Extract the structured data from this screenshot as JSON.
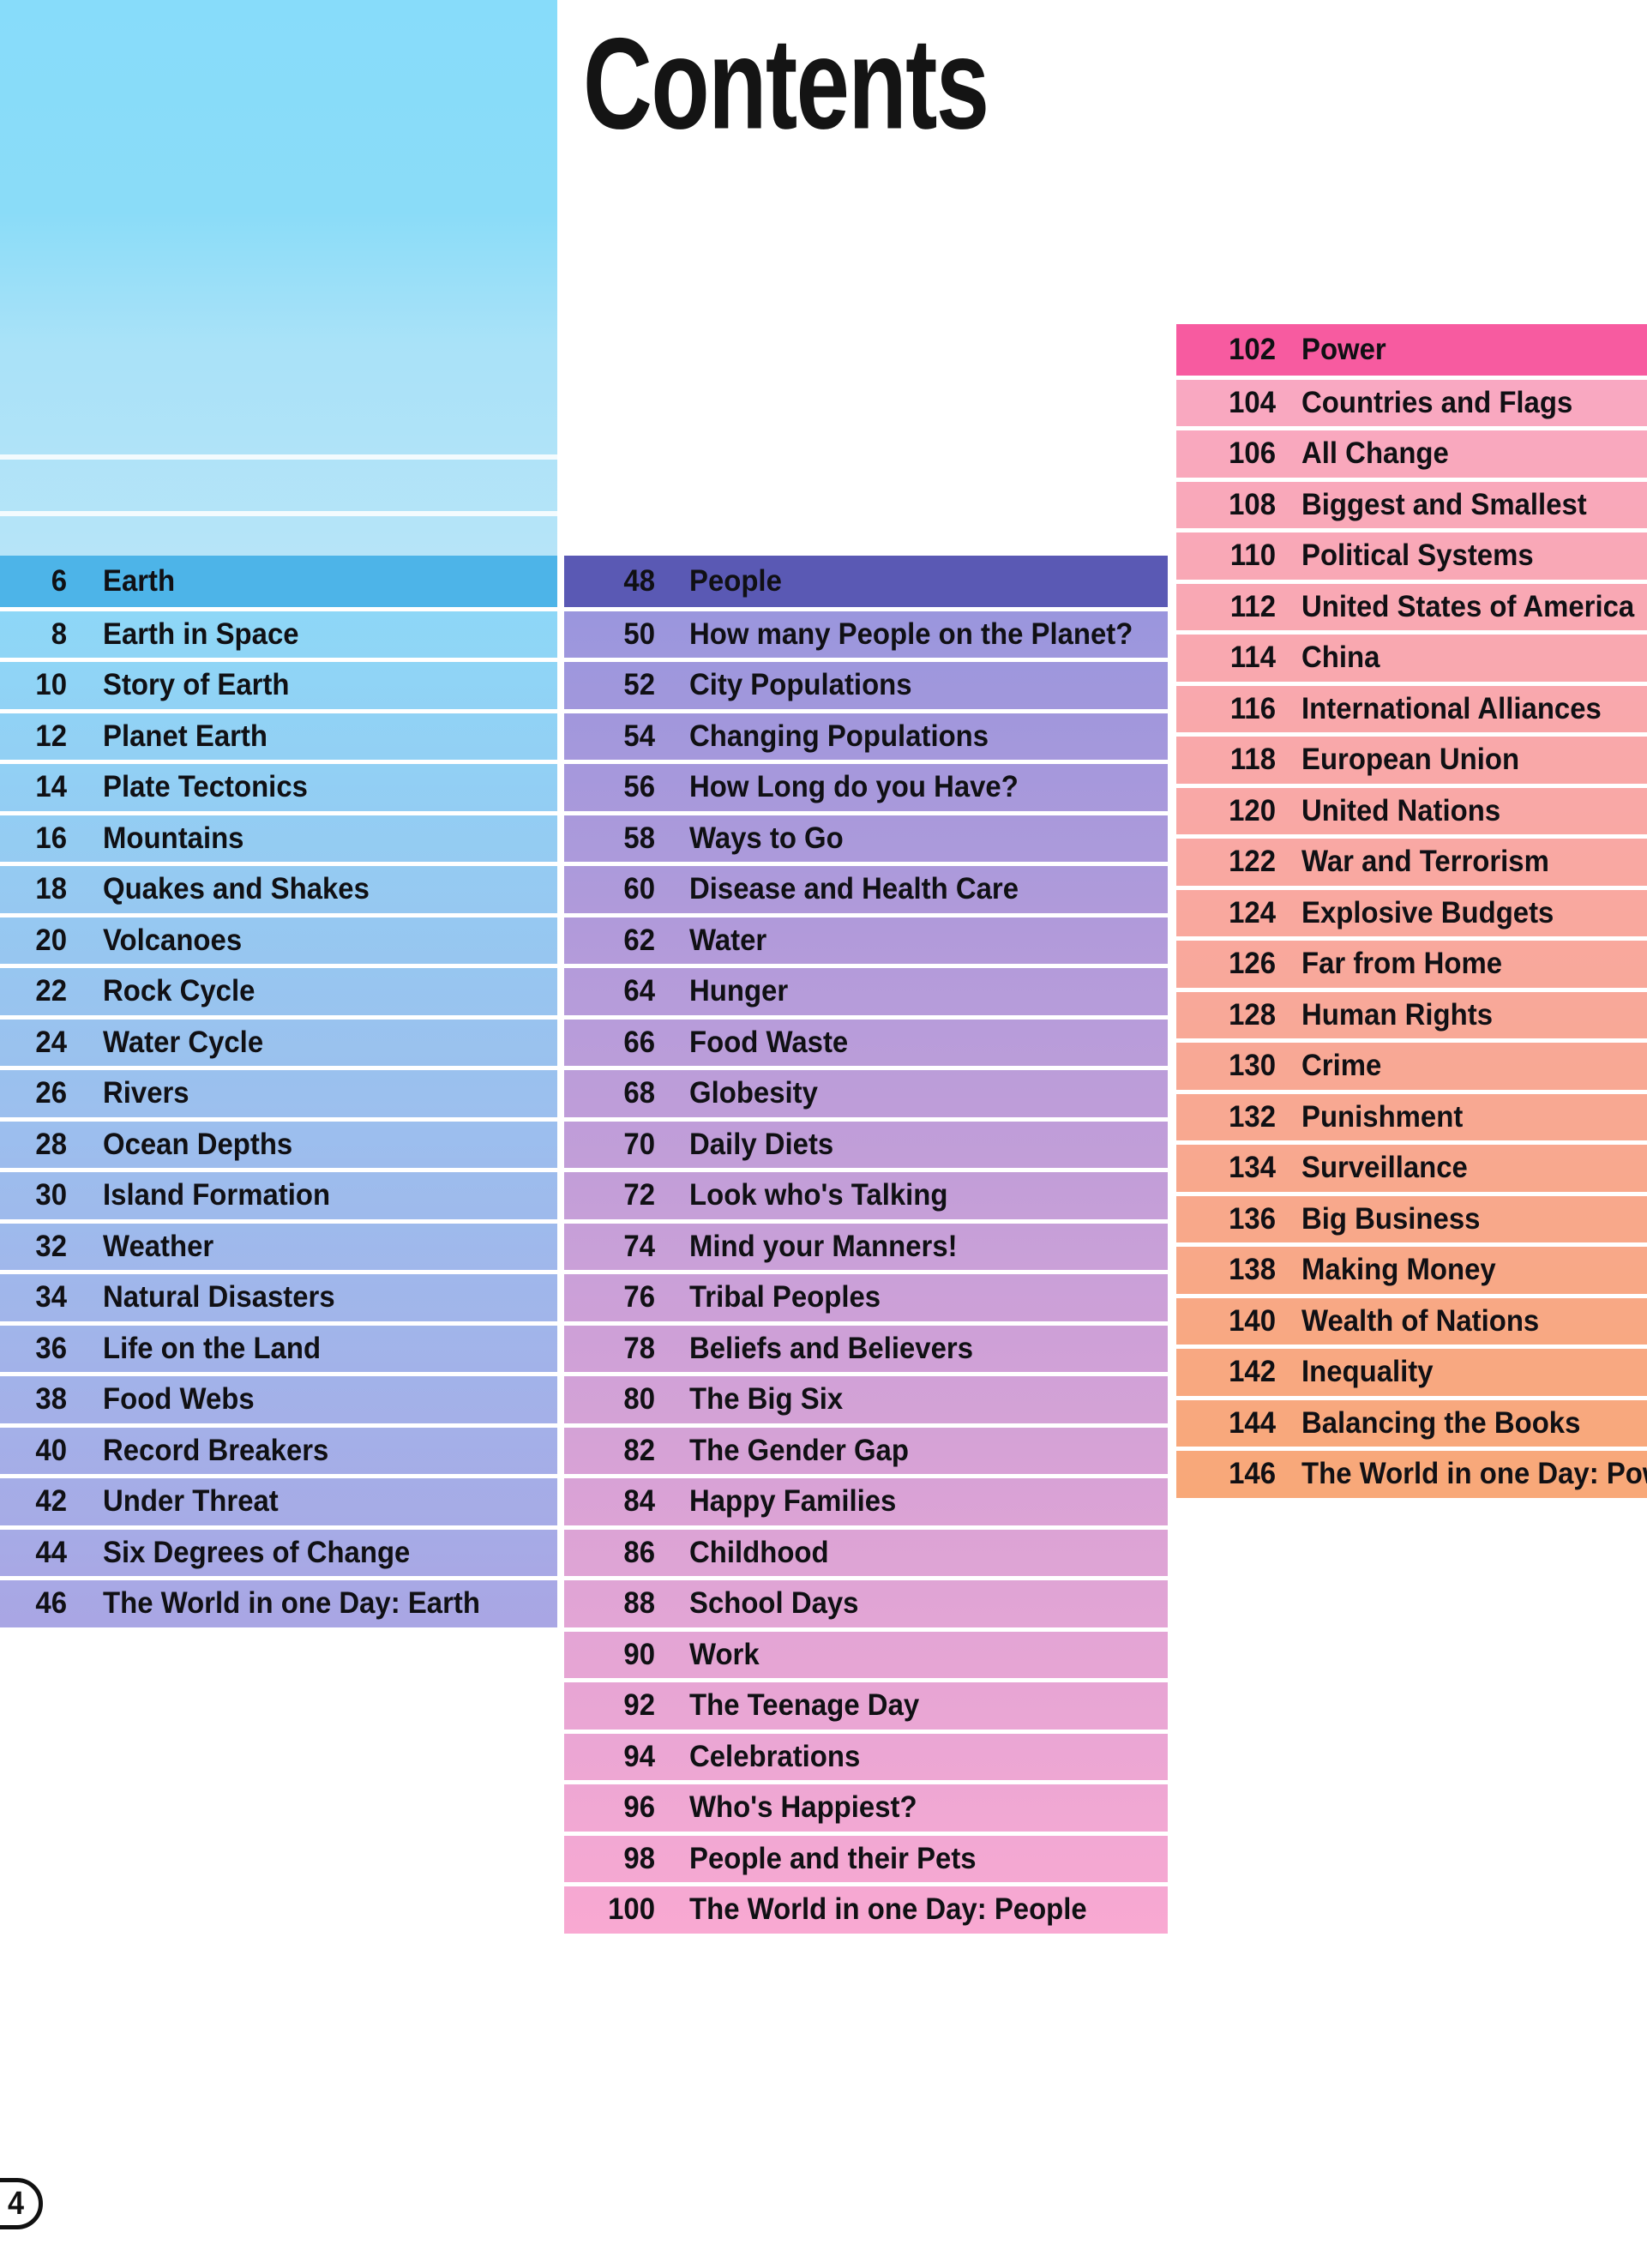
{
  "page": {
    "title": "Contents",
    "page_number": "4"
  },
  "colors": {
    "earth_top": "#87dcfa",
    "earth_header_row": "#4db4e8",
    "earth_bottom": "#a9a6e4",
    "people_header_row": "#5a59b4",
    "people_top": "#9a96dd",
    "people_bottom": "#f9a9d2",
    "power_header_row": "#f75ba0",
    "power_top": "#f9a8c2",
    "power_bottom": "#f8a878",
    "text": "#101014",
    "divider": "#ffffff"
  },
  "columns": [
    {
      "name": "earth",
      "header_index": 0,
      "entries": [
        {
          "page": "6",
          "title": "Earth"
        },
        {
          "page": "8",
          "title": "Earth in Space"
        },
        {
          "page": "10",
          "title": "Story of Earth"
        },
        {
          "page": "12",
          "title": "Planet Earth"
        },
        {
          "page": "14",
          "title": "Plate Tectonics"
        },
        {
          "page": "16",
          "title": "Mountains"
        },
        {
          "page": "18",
          "title": "Quakes and Shakes"
        },
        {
          "page": "20",
          "title": "Volcanoes"
        },
        {
          "page": "22",
          "title": "Rock Cycle"
        },
        {
          "page": "24",
          "title": "Water Cycle"
        },
        {
          "page": "26",
          "title": "Rivers"
        },
        {
          "page": "28",
          "title": "Ocean Depths"
        },
        {
          "page": "30",
          "title": "Island Formation"
        },
        {
          "page": "32",
          "title": "Weather"
        },
        {
          "page": "34",
          "title": "Natural Disasters"
        },
        {
          "page": "36",
          "title": "Life on the Land"
        },
        {
          "page": "38",
          "title": "Food Webs"
        },
        {
          "page": "40",
          "title": "Record Breakers"
        },
        {
          "page": "42",
          "title": "Under Threat"
        },
        {
          "page": "44",
          "title": "Six Degrees of Change"
        },
        {
          "page": "46",
          "title": "The World in one Day: Earth"
        }
      ]
    },
    {
      "name": "people",
      "header_index": 0,
      "entries": [
        {
          "page": "48",
          "title": "People"
        },
        {
          "page": "50",
          "title": "How many People on the Planet?"
        },
        {
          "page": "52",
          "title": "City Populations"
        },
        {
          "page": "54",
          "title": "Changing Populations"
        },
        {
          "page": "56",
          "title": "How Long do you Have?"
        },
        {
          "page": "58",
          "title": "Ways to Go"
        },
        {
          "page": "60",
          "title": "Disease and Health Care"
        },
        {
          "page": "62",
          "title": "Water"
        },
        {
          "page": "64",
          "title": "Hunger"
        },
        {
          "page": "66",
          "title": "Food Waste"
        },
        {
          "page": "68",
          "title": "Globesity"
        },
        {
          "page": "70",
          "title": "Daily Diets"
        },
        {
          "page": "72",
          "title": "Look who's Talking"
        },
        {
          "page": "74",
          "title": "Mind your Manners!"
        },
        {
          "page": "76",
          "title": "Tribal Peoples"
        },
        {
          "page": "78",
          "title": "Beliefs and Believers"
        },
        {
          "page": "80",
          "title": "The Big Six"
        },
        {
          "page": "82",
          "title": "The Gender Gap"
        },
        {
          "page": "84",
          "title": "Happy Families"
        },
        {
          "page": "86",
          "title": "Childhood"
        },
        {
          "page": "88",
          "title": "School Days"
        },
        {
          "page": "90",
          "title": "Work"
        },
        {
          "page": "92",
          "title": "The Teenage Day"
        },
        {
          "page": "94",
          "title": "Celebrations"
        },
        {
          "page": "96",
          "title": "Who's Happiest?"
        },
        {
          "page": "98",
          "title": "People and their Pets"
        },
        {
          "page": "100",
          "title": "The World in one Day: People"
        }
      ]
    },
    {
      "name": "power",
      "header_index": 0,
      "entries": [
        {
          "page": "102",
          "title": "Power"
        },
        {
          "page": "104",
          "title": "Countries and Flags"
        },
        {
          "page": "106",
          "title": "All Change"
        },
        {
          "page": "108",
          "title": "Biggest and Smallest"
        },
        {
          "page": "110",
          "title": "Political Systems"
        },
        {
          "page": "112",
          "title": "United States of America"
        },
        {
          "page": "114",
          "title": "China"
        },
        {
          "page": "116",
          "title": "International Alliances"
        },
        {
          "page": "118",
          "title": "European Union"
        },
        {
          "page": "120",
          "title": "United Nations"
        },
        {
          "page": "122",
          "title": "War and Terrorism"
        },
        {
          "page": "124",
          "title": "Explosive Budgets"
        },
        {
          "page": "126",
          "title": "Far from Home"
        },
        {
          "page": "128",
          "title": "Human Rights"
        },
        {
          "page": "130",
          "title": "Crime"
        },
        {
          "page": "132",
          "title": "Punishment"
        },
        {
          "page": "134",
          "title": "Surveillance"
        },
        {
          "page": "136",
          "title": "Big Business"
        },
        {
          "page": "138",
          "title": "Making Money"
        },
        {
          "page": "140",
          "title": "Wealth of Nations"
        },
        {
          "page": "142",
          "title": "Inequality"
        },
        {
          "page": "144",
          "title": "Balancing the Books"
        },
        {
          "page": "146",
          "title": "The World in one Day: Power"
        }
      ]
    }
  ]
}
